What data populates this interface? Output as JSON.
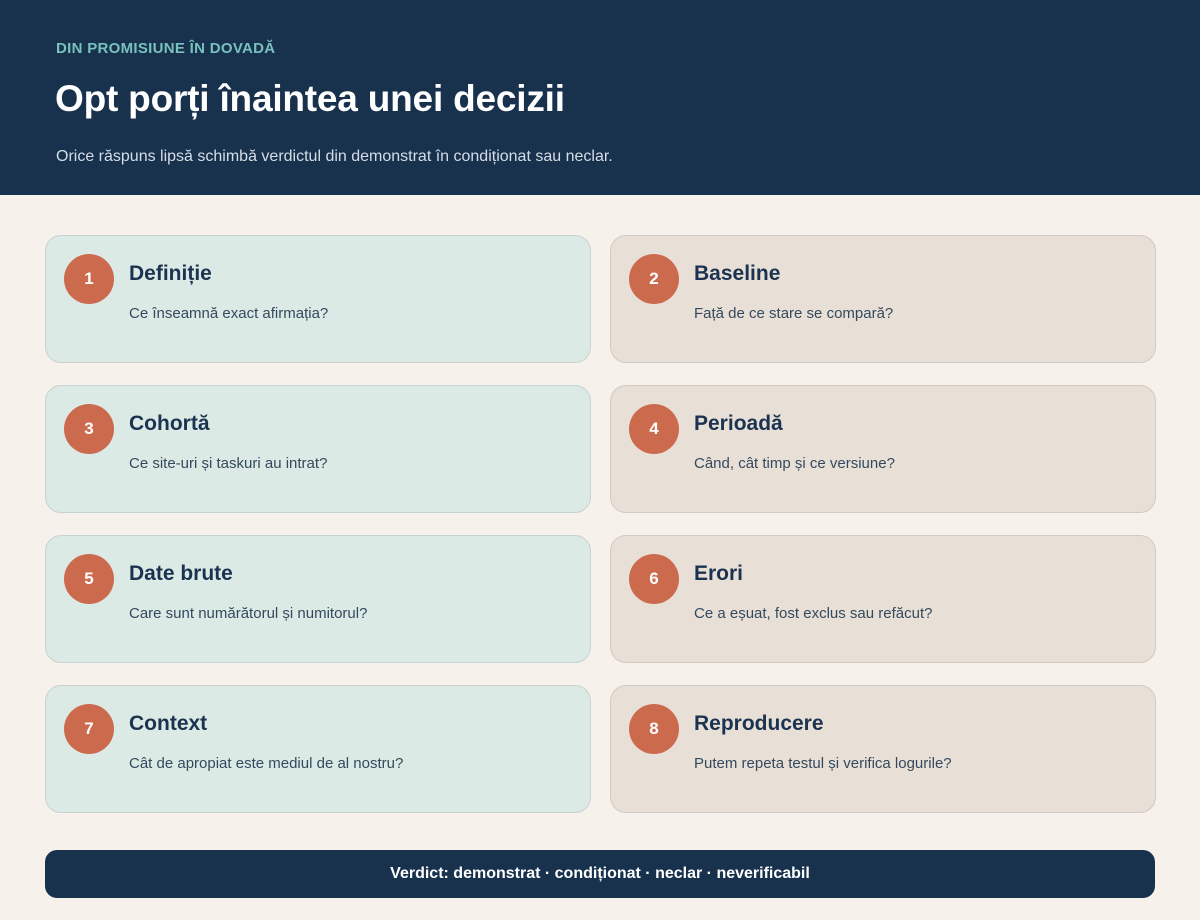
{
  "header": {
    "eyebrow": "DIN PROMISIUNE ÎN DOVADĂ",
    "title": "Opt porți înaintea unei decizii",
    "subtitle": "Orice răspuns lipsă schimbă verdictul din demonstrat în condiționat sau neclar."
  },
  "gates": [
    {
      "number": "1",
      "title": "Definiție",
      "question": "Ce înseamnă exact afirmația?"
    },
    {
      "number": "2",
      "title": "Baseline",
      "question": "Față de ce stare se compară?"
    },
    {
      "number": "3",
      "title": "Cohortă",
      "question": "Ce site-uri și taskuri au intrat?"
    },
    {
      "number": "4",
      "title": "Perioadă",
      "question": "Când, cât timp și ce versiune?"
    },
    {
      "number": "5",
      "title": "Date brute",
      "question": "Care sunt numărătorul și numitorul?"
    },
    {
      "number": "6",
      "title": "Erori",
      "question": "Ce a eșuat, fost exclus sau refăcut?"
    },
    {
      "number": "7",
      "title": "Context",
      "question": "Cât de apropiat este mediul de al nostru?"
    },
    {
      "number": "8",
      "title": "Reproducere",
      "question": "Putem repeta testul și verifica logurile?"
    }
  ],
  "footer": {
    "verdict": "Verdict: demonstrat · condiționat · neclar · neverificabil"
  },
  "colors": {
    "header_bg": "#18324e",
    "accent_teal": "#78c1bd",
    "badge": "#cc6a4e",
    "card_left_bg": "#dceae5",
    "card_right_bg": "#e8e0d6",
    "page_bg": "#f6f1ea"
  }
}
